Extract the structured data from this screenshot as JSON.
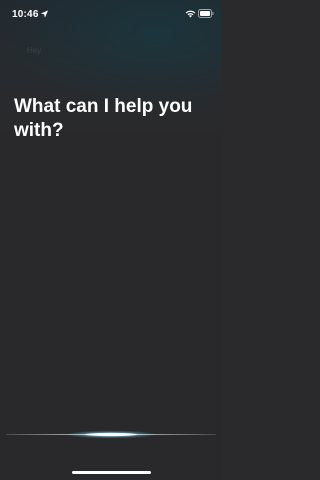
{
  "status_bar": {
    "time": "10:46",
    "icons": [
      "location-arrow-icon",
      "wifi-icon",
      "battery-icon"
    ]
  },
  "background": {
    "faded_text": "Hey"
  },
  "siri": {
    "prompt": "What can I help you with?"
  },
  "colors": {
    "background": "#29292b",
    "text": "#ffffff",
    "waveform_glow": "#c8f4ff"
  }
}
